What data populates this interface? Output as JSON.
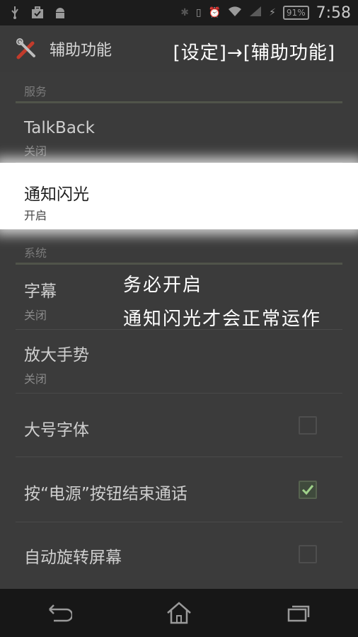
{
  "status_bar": {
    "time": "7:58",
    "battery": "91%",
    "left_icons": [
      "usb-icon",
      "briefcase-check-icon",
      "android-icon"
    ],
    "right_icons": [
      "bluetooth-icon",
      "vibrate-icon",
      "alarm-icon",
      "wifi-icon",
      "signal-icon",
      "charging-icon"
    ]
  },
  "action_bar": {
    "title": "辅助功能",
    "icon": "tools-icon"
  },
  "overlay_path": "[设定]→[辅助功能]",
  "sections": {
    "services_header": "服务",
    "system_header": "系统"
  },
  "items": {
    "talkback": {
      "title": "TalkBack",
      "subtitle": "关闭"
    },
    "notification_flash": {
      "title": "通知闪光",
      "subtitle": "开启"
    },
    "captions": {
      "title": "字幕",
      "subtitle": "关闭"
    },
    "magnification": {
      "title": "放大手势",
      "subtitle": "关闭"
    },
    "large_text": {
      "title": "大号字体",
      "checked": false
    },
    "power_ends_call": {
      "title": "按“电源”按钮结束通话",
      "checked": true
    },
    "auto_rotate": {
      "title": "自动旋转屏幕",
      "checked": false
    }
  },
  "notes": {
    "line1": "务必开启",
    "line2": "通知闪光才会正常运作"
  },
  "nav_bar": [
    "back-icon",
    "home-icon",
    "recents-icon"
  ],
  "colors": {
    "background": "#3b3b3b",
    "status_bar": "#1c1c1c",
    "nav_bar": "#171717",
    "highlight": "#ffffff",
    "section_rule": "#50544a"
  }
}
